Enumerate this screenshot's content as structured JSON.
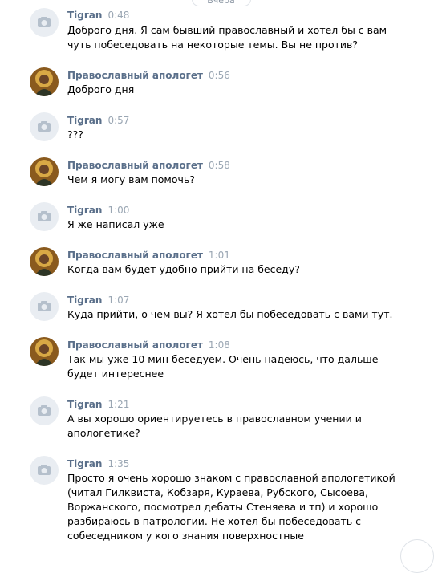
{
  "day_label": "Вчера",
  "messages": [
    {
      "author": "Tigran",
      "time": "0:48",
      "avatar": "camera-icon",
      "text": "Доброго дня. Я сам бывший православный и хотел бы с вам\nчуть побеседовать на некоторые темы. Вы не против?"
    },
    {
      "author": "Православный апологет",
      "time": "0:56",
      "avatar": "saint-icon",
      "text": "Доброго дня"
    },
    {
      "author": "Tigran",
      "time": "0:57",
      "avatar": "camera-icon",
      "text": "???"
    },
    {
      "author": "Православный апологет",
      "time": "0:58",
      "avatar": "saint-icon",
      "text": "Чем я могу вам помочь?"
    },
    {
      "author": "Tigran",
      "time": "1:00",
      "avatar": "camera-icon",
      "text": "Я же написал уже"
    },
    {
      "author": "Православный апологет",
      "time": "1:01",
      "avatar": "saint-icon",
      "text": "Когда вам будет удобно прийти на беседу?"
    },
    {
      "author": "Tigran",
      "time": "1:07",
      "avatar": "camera-icon",
      "text": "Куда прийти, о чем вы? Я хотел бы побеседовать с вами тут."
    },
    {
      "author": "Православный апологет",
      "time": "1:08",
      "avatar": "saint-icon",
      "text": "Так мы уже 10 мин беседуем. Очень надеюсь, что дальше\nбудет интереснее"
    },
    {
      "author": "Tigran",
      "time": "1:21",
      "avatar": "camera-icon",
      "text": "А вы хорошо ориентируетесь в православном учении и\nапологетике?"
    },
    {
      "author": "Tigran",
      "time": "1:35",
      "avatar": "camera-icon",
      "text": "Просто я очень хорошо знаком с православной апологетикой\n(читал Гилквиста, Кобзаря, Кураева, Рубского, Сысоева,\nВоржанского, посмотрел дебаты Стеняева и тп) и хорошо\nразбираюсь в патрологии. Не хотел бы побеседовать с\nсобеседником у кого знания поверхностные"
    }
  ]
}
